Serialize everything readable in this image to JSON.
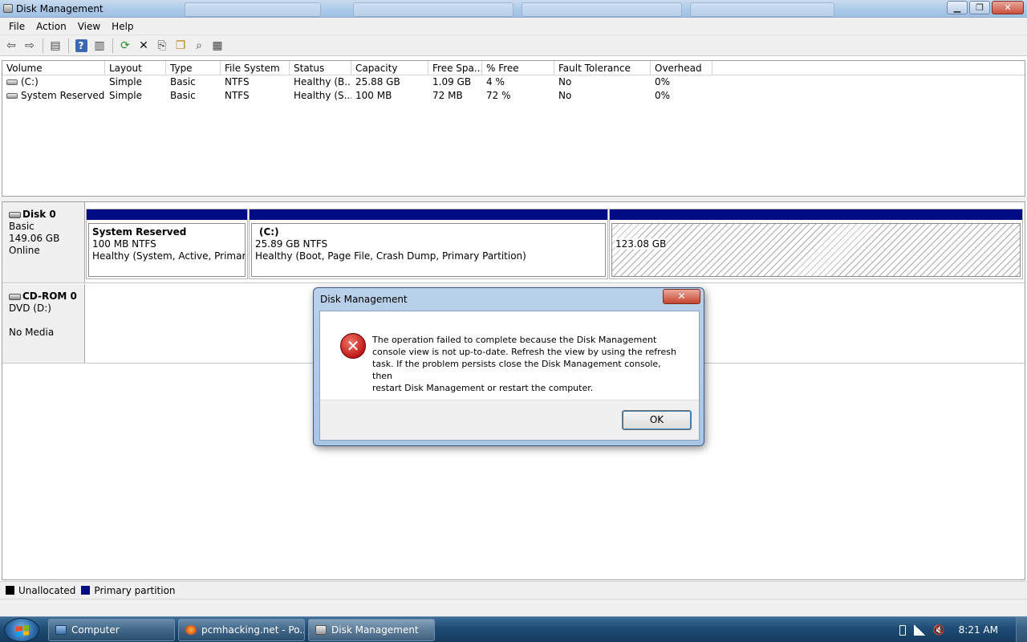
{
  "window": {
    "title": "Disk Management"
  },
  "menu": [
    "File",
    "Action",
    "View",
    "Help"
  ],
  "toolbar": [
    {
      "icon": "back-arrow-icon",
      "glyph": "⇦"
    },
    {
      "icon": "forward-arrow-icon",
      "glyph": "⇨"
    },
    {
      "icon": "console-tree-icon",
      "glyph": "▤"
    },
    {
      "icon": "help-icon",
      "glyph": "?"
    },
    {
      "icon": "properties-icon",
      "glyph": "▥"
    },
    {
      "icon": "refresh-icon",
      "glyph": "⟳"
    },
    {
      "icon": "delete-icon",
      "glyph": "✕"
    },
    {
      "icon": "export-icon",
      "glyph": "⎘"
    },
    {
      "icon": "open-folder-icon",
      "glyph": "❐"
    },
    {
      "icon": "search-icon",
      "glyph": "⌕"
    },
    {
      "icon": "settings-icon",
      "glyph": "▦"
    }
  ],
  "volume_table": {
    "columns": [
      "Volume",
      "Layout",
      "Type",
      "File System",
      "Status",
      "Capacity",
      "Free Spa...",
      "% Free",
      "Fault Tolerance",
      "Overhead"
    ],
    "rows": [
      {
        "volume": "(C:)",
        "layout": "Simple",
        "type": "Basic",
        "fs": "NTFS",
        "status": "Healthy (B...",
        "capacity": "25.88 GB",
        "free": "1.09 GB",
        "pct": "4 %",
        "ft": "No",
        "overhead": "0%"
      },
      {
        "volume": "System Reserved",
        "layout": "Simple",
        "type": "Basic",
        "fs": "NTFS",
        "status": "Healthy (S...",
        "capacity": "100 MB",
        "free": "72 MB",
        "pct": "72 %",
        "ft": "No",
        "overhead": "0%"
      }
    ]
  },
  "disks": {
    "disk0": {
      "name": "Disk 0",
      "kind": "Basic",
      "size": "149.06 GB",
      "state": "Online",
      "partitions": [
        {
          "title": "System Reserved",
          "size": "100 MB NTFS",
          "status": "Healthy (System, Active, Primary Pa"
        },
        {
          "title": "(C:)",
          "size": "25.89 GB NTFS",
          "status": "Healthy (Boot, Page File, Crash Dump, Primary Partition)"
        },
        {
          "size": "123.08 GB"
        }
      ]
    },
    "cdrom0": {
      "name": "CD-ROM 0",
      "drive": "DVD (D:)",
      "media": "No Media"
    }
  },
  "legend": [
    {
      "label": "Unallocated",
      "color": "#000000"
    },
    {
      "label": "Primary partition",
      "color": "#000c84"
    }
  ],
  "dialog": {
    "title": "Disk Management",
    "close_label": "✕",
    "message_lines": [
      "The operation failed to complete because the Disk Management",
      "console view is not up-to-date.  Refresh the view by using the refresh",
      "task. If the problem persists close the Disk Management console, then",
      "restart Disk Management or restart the computer."
    ],
    "ok_label": "OK"
  },
  "taskbar": {
    "items": [
      {
        "label": "Computer"
      },
      {
        "label": "pcmhacking.net - Po..."
      },
      {
        "label": "Disk Management"
      }
    ],
    "clock": "8:21 AM"
  },
  "colors": {
    "primary_partition": "#000c84",
    "unallocated": "#000000",
    "error": "#c01818"
  }
}
